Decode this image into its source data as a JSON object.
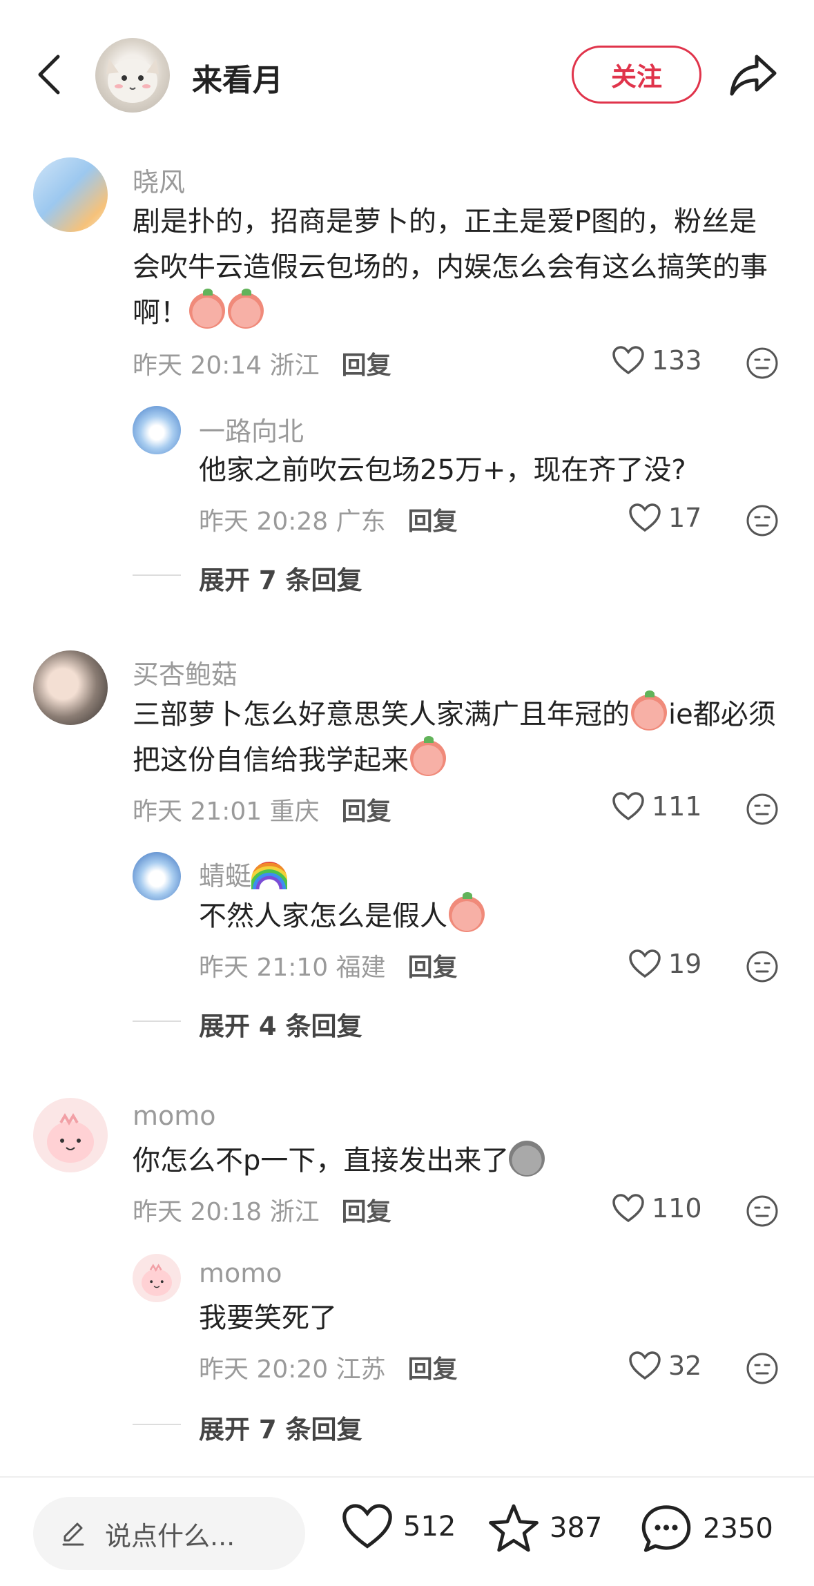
{
  "header": {
    "author_name": "来看月",
    "follow_label": "关注",
    "icons": [
      "chevron-left-icon",
      "share-icon"
    ]
  },
  "comments": [
    {
      "user": "晓风",
      "text": "剧是扑的，招商是萝卜的，正主是爱P图的，粉丝是会吹牛云造假云包场的，内娱怎么会有这么搞笑的事啊！",
      "time": "昨天 20:14 浙江",
      "reply_label": "回复",
      "likes": "133",
      "reply": {
        "user": "一路向北",
        "text": "他家之前吹云包场25万+，现在齐了没?",
        "time": "昨天 20:28 广东",
        "reply_label": "回复",
        "likes": "17"
      },
      "expand": "展开 7 条回复"
    },
    {
      "user": "买杏鲍菇",
      "text": "三部萝卜怎么好意思笑人家满广且年冠的",
      "text_tail": "ie都必须把这份自信给我学起来",
      "time": "昨天 21:01 重庆",
      "reply_label": "回复",
      "likes": "111",
      "reply": {
        "user": "蜻蜓",
        "text": "不然人家怎么是假人",
        "time": "昨天 21:10 福建",
        "reply_label": "回复",
        "likes": "19"
      },
      "expand": "展开 4 条回复"
    },
    {
      "user": "momo",
      "text": "你怎么不p一下，直接发出来了",
      "time": "昨天 20:18 浙江",
      "reply_label": "回复",
      "likes": "110",
      "reply": {
        "user": "momo",
        "text": "我要笑死了",
        "time": "昨天 20:20 江苏",
        "reply_label": "回复",
        "likes": "32"
      },
      "expand": "展开 7 条回复"
    }
  ],
  "bottom": {
    "placeholder": "说点什么...",
    "likes": "512",
    "stars": "387",
    "comments": "2350"
  },
  "colors": {
    "accent": "#e0344b"
  }
}
